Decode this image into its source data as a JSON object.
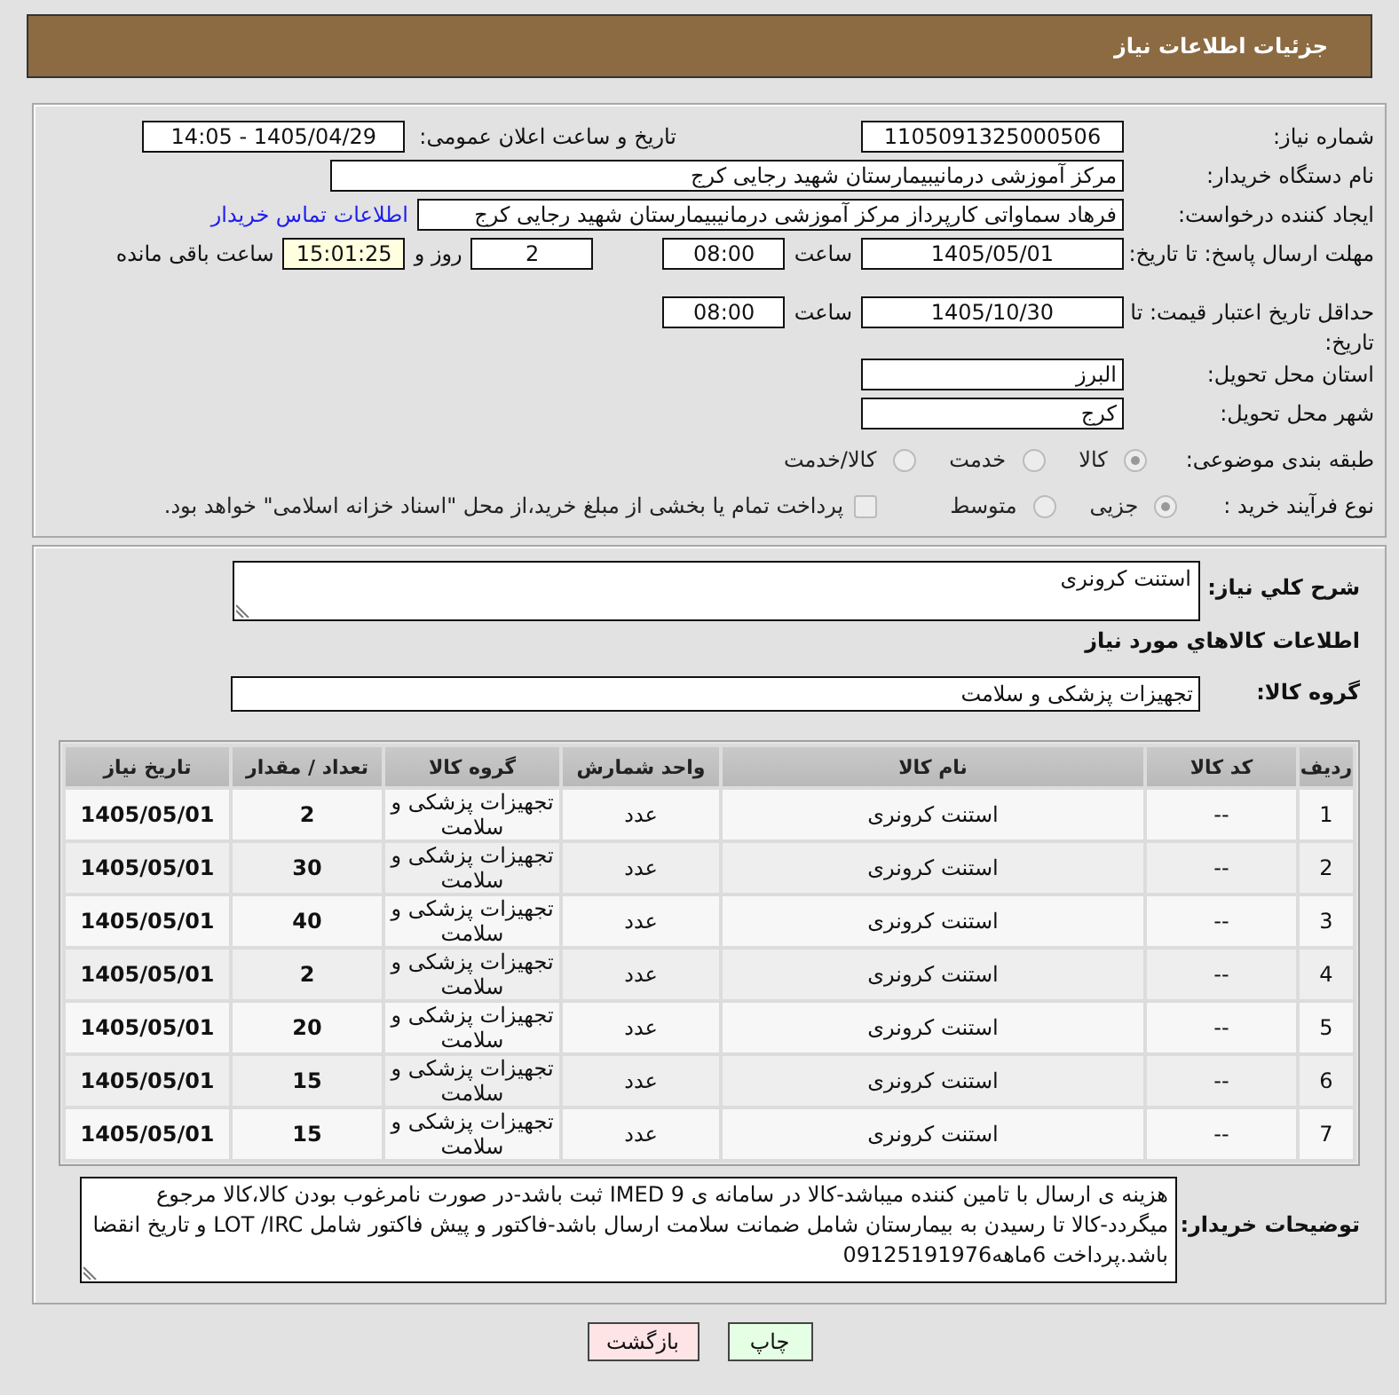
{
  "header": {
    "title": "جزئیات اطلاعات نیاز"
  },
  "details": {
    "need_number": {
      "label": "شماره نیاز:",
      "value": "1105091325000506"
    },
    "announce_datetime": {
      "label": "تاریخ و ساعت اعلان عمومی:",
      "value": "1405/04/29 - 14:05"
    },
    "buyer_org": {
      "label": "نام دستگاه خریدار:",
      "value": "مرکز آموزشی درمانیبیمارستان شهید رجایی کرج"
    },
    "requester": {
      "label": "ایجاد کننده درخواست:",
      "value": "فرهاد سماواتی کارپرداز مرکز آموزشی درمانیبیمارستان شهید رجایی کرج",
      "contact_link": "اطلاعات تماس خریدار"
    },
    "response_deadline": {
      "label": "مهلت ارسال پاسخ: تا تاریخ:",
      "date": "1405/05/01",
      "time_label": "ساعت",
      "time": "08:00",
      "days": "2",
      "days_label": "روز و",
      "remaining": "15:01:25",
      "remaining_label": "ساعت باقی مانده"
    },
    "price_validity": {
      "label": "حداقل تاریخ اعتبار قیمت: تا تاریخ:",
      "date": "1405/10/30",
      "time_label": "ساعت",
      "time": "08:00"
    },
    "delivery_province": {
      "label": "استان محل تحویل:",
      "value": "البرز"
    },
    "delivery_city": {
      "label": "شهر محل تحویل:",
      "value": "کرج"
    },
    "category": {
      "label": "طبقه بندی موضوعی:",
      "options": [
        {
          "label": "کالا",
          "selected": true
        },
        {
          "label": "خدمت",
          "selected": false
        },
        {
          "label": "کالا/خدمت",
          "selected": false
        }
      ]
    },
    "purchase_type": {
      "label": "نوع فرآیند خرید :",
      "options": [
        {
          "label": "جزیی",
          "selected": true
        },
        {
          "label": "متوسط",
          "selected": false
        }
      ],
      "treasury_payment": {
        "label": "پرداخت تمام یا بخشی از مبلغ خرید،از محل \"اسناد خزانه اسلامی\" خواهد بود.",
        "checked": false
      }
    }
  },
  "need": {
    "summary_label": "شرح کلي نیاز:",
    "summary": "استنت کرونری",
    "items_heading": "اطلاعات کالاهاي مورد نیاز",
    "group_label": "گروه کالا:",
    "group": "تجهیزات پزشکی و سلامت"
  },
  "table": {
    "columns": [
      "ردیف",
      "کد کالا",
      "نام کالا",
      "واحد شمارش",
      "گروه کالا",
      "تعداد / مقدار",
      "تاریخ نیاز"
    ],
    "rows": [
      [
        "1",
        "--",
        "استنت کرونری",
        "عدد",
        "تجهیزات پزشکی و سلامت",
        "2",
        "1405/05/01"
      ],
      [
        "2",
        "--",
        "استنت کرونری",
        "عدد",
        "تجهیزات پزشکی و سلامت",
        "30",
        "1405/05/01"
      ],
      [
        "3",
        "--",
        "استنت کرونری",
        "عدد",
        "تجهیزات پزشکی و سلامت",
        "40",
        "1405/05/01"
      ],
      [
        "4",
        "--",
        "استنت کرونری",
        "عدد",
        "تجهیزات پزشکی و سلامت",
        "2",
        "1405/05/01"
      ],
      [
        "5",
        "--",
        "استنت کرونری",
        "عدد",
        "تجهیزات پزشکی و سلامت",
        "20",
        "1405/05/01"
      ],
      [
        "6",
        "--",
        "استنت کرونری",
        "عدد",
        "تجهیزات پزشکی و سلامت",
        "15",
        "1405/05/01"
      ],
      [
        "7",
        "--",
        "استنت کرونری",
        "عدد",
        "تجهیزات پزشکی و سلامت",
        "15",
        "1405/05/01"
      ]
    ]
  },
  "buyer_notes": {
    "label": "توضیحات خریدار:",
    "text": "هزینه ی ارسال با تامین کننده میباشد-کالا در سامانه ی IMED 9 ثبت باشد-در صورت نامرغوب بودن کالا،کالا مرجوع میگردد-کالا تا رسیدن به بیمارستان شامل ضمانت سلامت ارسال باشد-فاکتور و پیش فاکتور شامل LOT /IRC و تاریخ انقضا باشد.پرداخت 6ماهه09125191976"
  },
  "buttons": [
    {
      "label": "چاپ",
      "kind": "print"
    },
    {
      "label": "بازگشت",
      "kind": "back"
    }
  ]
}
